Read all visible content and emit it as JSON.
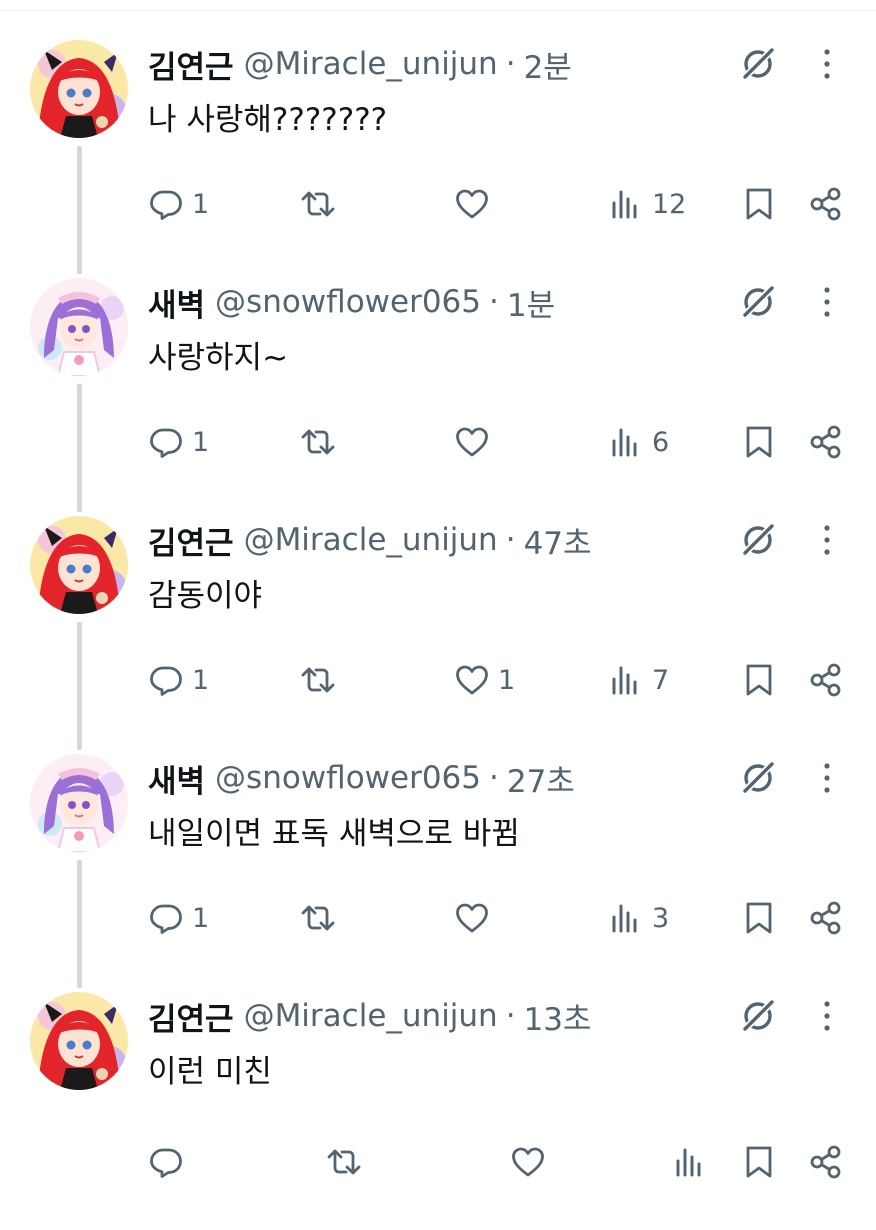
{
  "colors": {
    "text": "#0f1419",
    "secondary": "#536471",
    "thread_line": "#cfd9de",
    "divider": "#eff3f4"
  },
  "icons": {
    "reply": "reply-icon",
    "retweet": "retweet-icon",
    "like": "heart-icon",
    "views": "views-icon",
    "bookmark": "bookmark-icon",
    "share": "share-icon",
    "grok": "grok-icon",
    "more": "more-icon"
  },
  "tweets": [
    {
      "author": "김연근",
      "handle": "@Miracle_unijun",
      "separator": "·",
      "time": "2분",
      "text": "나 사랑해???????",
      "replies": "1",
      "retweets": "",
      "likes": "",
      "views": "12",
      "avatar": "red-hair"
    },
    {
      "author": "새벽",
      "handle": "@snowflower065",
      "separator": "·",
      "time": "1분",
      "text": "사랑하지~",
      "replies": "1",
      "retweets": "",
      "likes": "",
      "views": "6",
      "avatar": "purple-hair"
    },
    {
      "author": "김연근",
      "handle": "@Miracle_unijun",
      "separator": "·",
      "time": "47초",
      "text": "감동이야",
      "replies": "1",
      "retweets": "",
      "likes": "1",
      "views": "7",
      "avatar": "red-hair"
    },
    {
      "author": "새벽",
      "handle": "@snowflower065",
      "separator": "·",
      "time": "27초",
      "text": "내일이면 표독 새벽으로 바뀜",
      "replies": "1",
      "retweets": "",
      "likes": "",
      "views": "3",
      "avatar": "purple-hair"
    },
    {
      "author": "김연근",
      "handle": "@Miracle_unijun",
      "separator": "·",
      "time": "13초",
      "text": "이런 미친",
      "replies": "",
      "retweets": "",
      "likes": "",
      "views": "",
      "avatar": "red-hair"
    }
  ]
}
